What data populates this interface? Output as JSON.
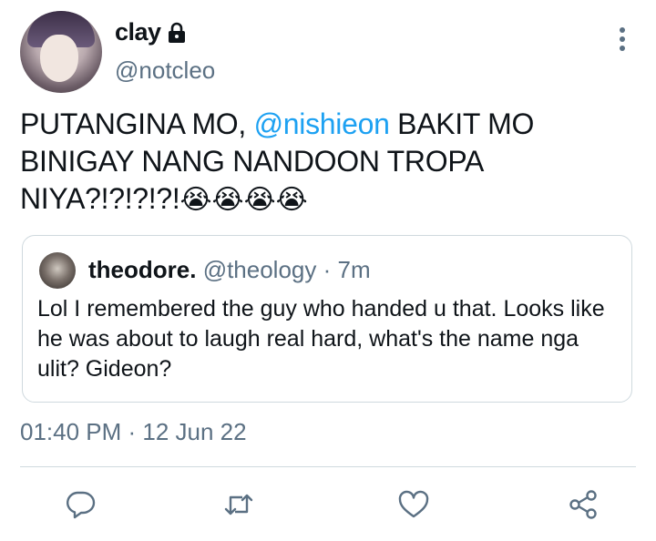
{
  "tweet": {
    "author": {
      "name": "clay",
      "handle": "@notcleo",
      "avatar_icon": "profile-photo",
      "protected_icon": "lock-icon"
    },
    "text_before": "PUTANGINA MO, ",
    "mention": "@nishieon",
    "text_after": " BAKIT MO BINIGAY NANG NANDOON TROPA NIYA?!?!?!?!",
    "emojis": "😭😭😭😭",
    "timestamp": "01:40 PM · 12 Jun 22",
    "quote": {
      "name": "theodore.",
      "handle": "@theology",
      "time": "· 7m",
      "text": "Lol I remembered the guy who handed u that. Looks like he was about to laugh real hard, what's the name nga ulit? Gideon?"
    }
  },
  "actions": [
    "reply-icon",
    "retweet-icon",
    "like-icon",
    "share-icon"
  ],
  "colors": {
    "text": "#0f1419",
    "secondary": "#5b7083",
    "link": "#1da1f2",
    "border": "#cfd9de"
  }
}
